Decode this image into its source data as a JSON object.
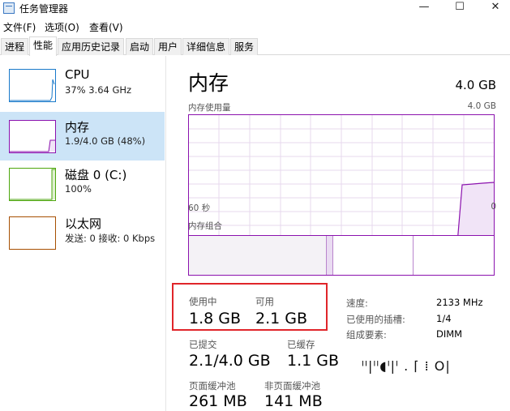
{
  "window": {
    "title": "任务管理器",
    "minimize": "—",
    "maximize": "☐",
    "close": "✕"
  },
  "menu": [
    "文件(F)",
    "选项(O)",
    "查看(V)"
  ],
  "tabs": [
    "进程",
    "性能",
    "应用历史记录",
    "启动",
    "用户",
    "详细信息",
    "服务"
  ],
  "active_tab": "性能",
  "sidebar": {
    "items": [
      {
        "name": "CPU",
        "sub": "37%  3.64 GHz",
        "color": "#1979ca"
      },
      {
        "name": "内存",
        "sub": "1.9/4.0 GB (48%)",
        "color": "#8b12ae"
      },
      {
        "name": "磁盘 0 (C:)",
        "sub": "100%",
        "color": "#4da60c"
      },
      {
        "name": "以太网",
        "sub": "发送: 0 接收: 0 Kbps",
        "color": "#a74f01"
      }
    ],
    "selected_index": 1
  },
  "memory": {
    "title": "内存",
    "total": "4.0 GB",
    "usage_label": "内存使用量",
    "usage_max": "4.0 GB",
    "axis_left": "60 秒",
    "axis_right": "0",
    "composition_label": "内存组合",
    "stats": {
      "in_use_label": "使用中",
      "in_use_value": "1.8 GB",
      "available_label": "可用",
      "available_value": "2.1 GB",
      "committed_label": "已提交",
      "committed_value": "2.1/4.0 GB",
      "cached_label": "已缓存",
      "cached_value": "1.1 GB",
      "paged_pool_label": "页面缓冲池",
      "paged_pool_value": "261 MB",
      "nonpaged_pool_label": "非页面缓冲池",
      "nonpaged_pool_value": "141 MB"
    },
    "details": {
      "speed_label": "速度:",
      "speed_value": "2133 MHz",
      "slots_label": "已使用的插槽:",
      "slots_value": "1/4",
      "form_factor_label": "组成要素:",
      "form_factor_value": "DIMM"
    },
    "graph_color": "#8b12ae"
  },
  "watermark_text": "ᴵᴵ|ᴵᴵ◖ᴵ|ᴵ . ⌈ ⁞ O|"
}
